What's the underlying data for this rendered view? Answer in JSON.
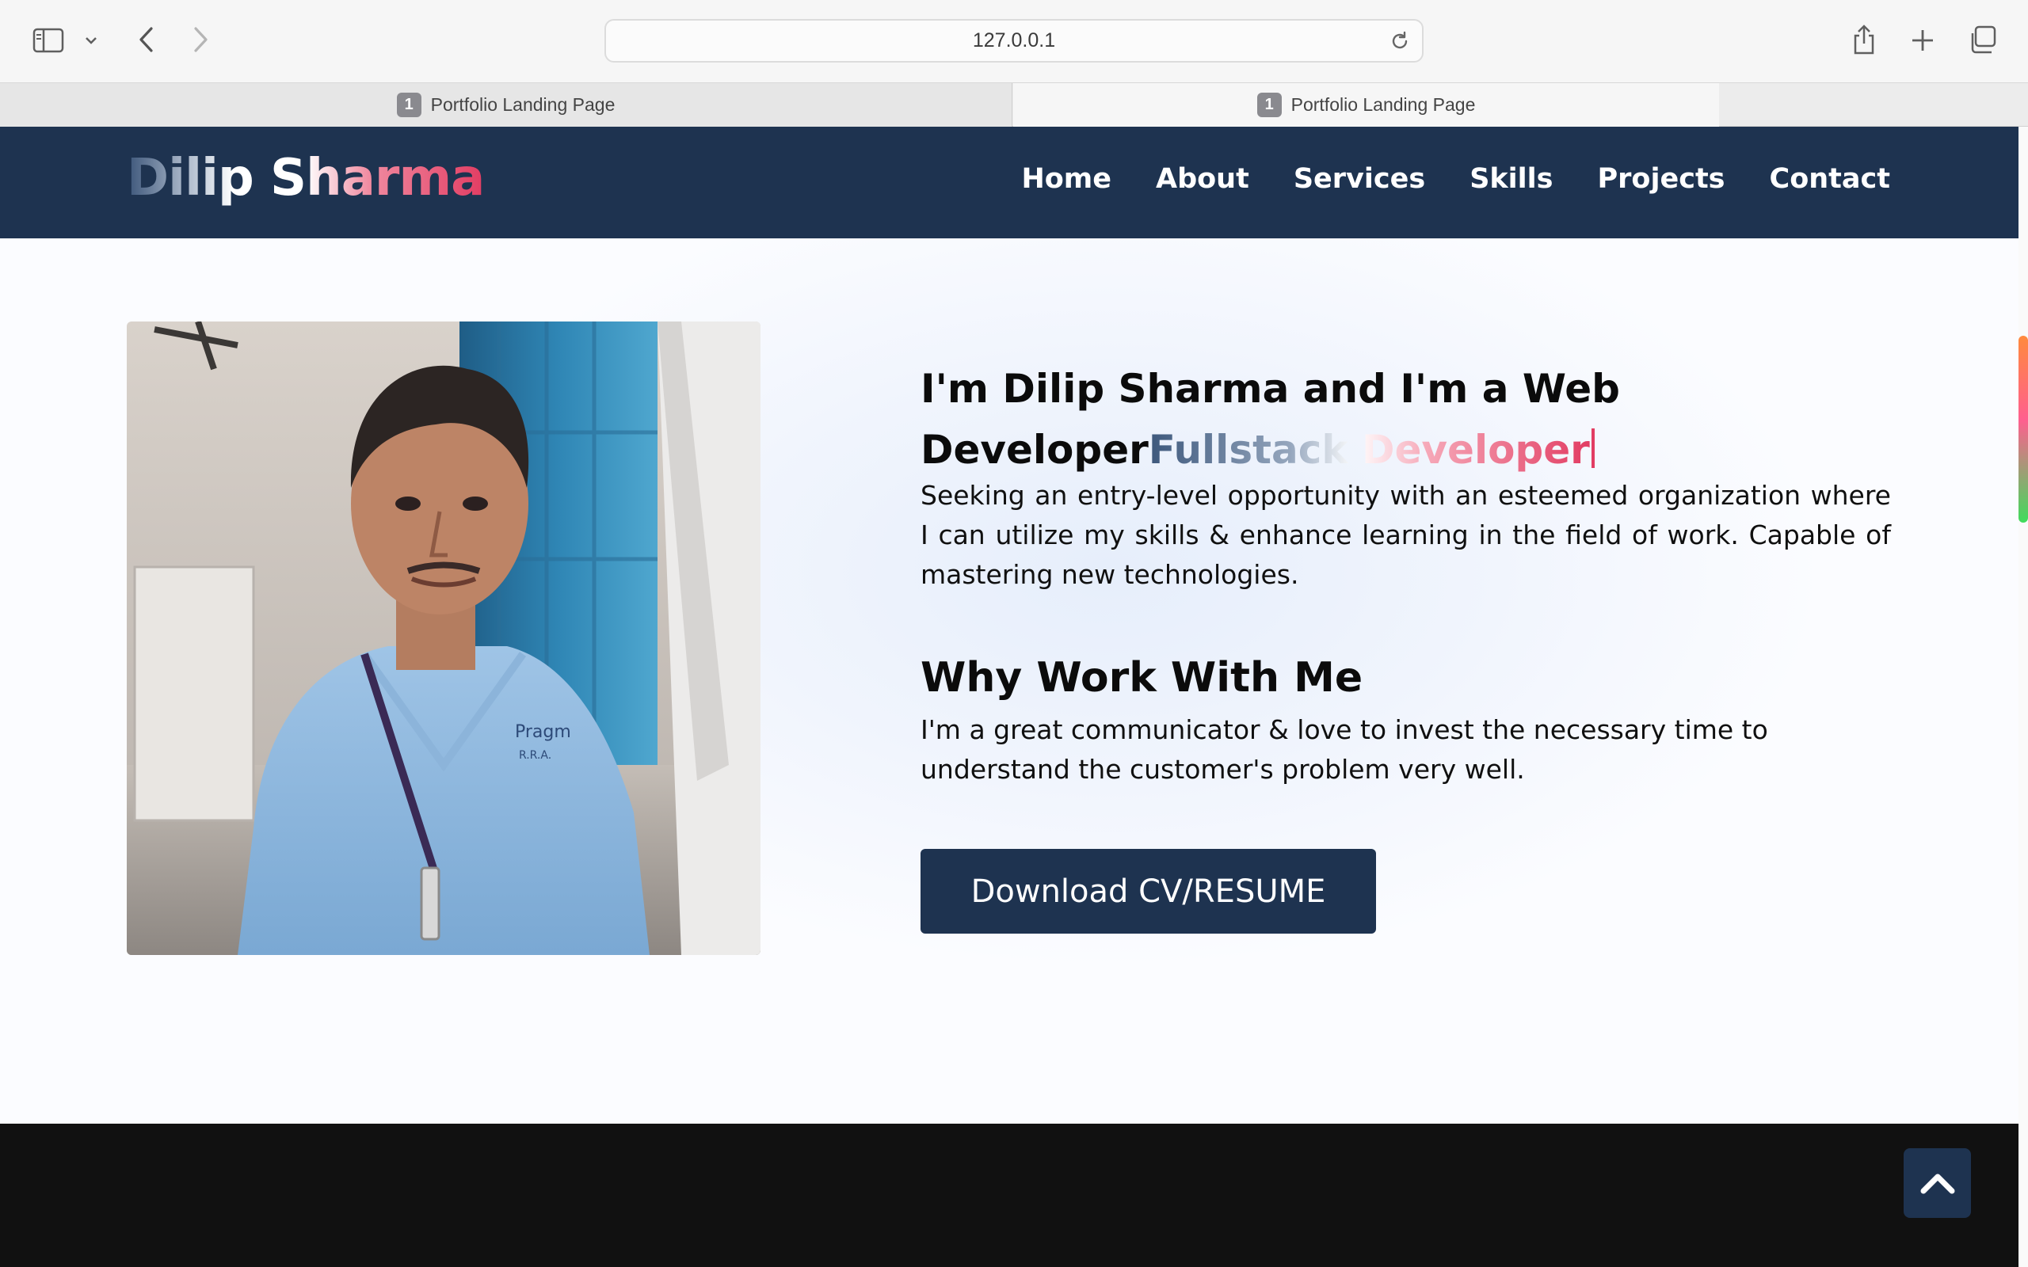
{
  "browser": {
    "url": "127.0.0.1",
    "tabs": [
      {
        "badge": "1",
        "title": "Portfolio Landing Page",
        "active": false
      },
      {
        "badge": "1",
        "title": "Portfolio Landing Page",
        "active": true
      }
    ]
  },
  "site": {
    "logo": "Dilip Sharma",
    "nav": [
      "Home",
      "About",
      "Services",
      "Skills",
      "Projects",
      "Contact"
    ]
  },
  "hero": {
    "headline_static": "I'm Dilip Sharma and I'm a Web Developer",
    "headline_typed": "Fullstack Developer",
    "intro": "Seeking an entry-level opportunity with an esteemed organization where I can utilize my skills & enhance learning in the field of work. Capable of mastering new technologies.",
    "why_title": "Why Work With Me",
    "why_text": "I'm a great communicator & love to invest the necessary time to understand the customer's problem very well.",
    "cta_label": "Download CV/RESUME"
  },
  "colors": {
    "navy": "#1e3350",
    "accent_pink": "#e23d63",
    "footer": "#111111"
  },
  "icons": [
    "sidebar-icon",
    "chevron-down-icon",
    "back-icon",
    "forward-icon",
    "reload-icon",
    "share-icon",
    "new-tab-icon",
    "tab-overview-icon",
    "chevron-up-icon"
  ]
}
